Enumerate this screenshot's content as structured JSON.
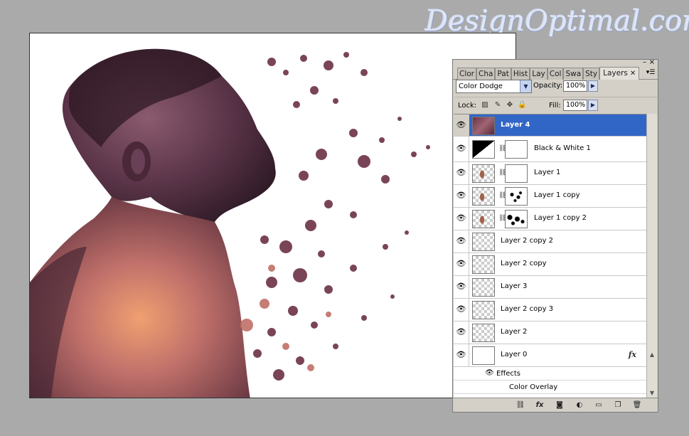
{
  "watermark": "DesignOptimal.com",
  "panel": {
    "tabs": [
      "Clor",
      "Cha",
      "Pat",
      "Hist",
      "Lay",
      "Col",
      "Swa",
      "Sty"
    ],
    "active_tab": "Layers",
    "blend_mode": "Color Dodge",
    "opacity_label": "Opacity:",
    "opacity_value": "100%",
    "lock_label": "Lock:",
    "fill_label": "Fill:",
    "fill_value": "100%",
    "layers": [
      {
        "name": "Layer 4",
        "thumb": "gradient",
        "selected": true
      },
      {
        "name": "Black & White 1",
        "thumb": "bw",
        "mask": "white"
      },
      {
        "name": "Layer 1",
        "thumb": "portrait",
        "mask": "white"
      },
      {
        "name": "Layer 1 copy",
        "thumb": "portrait",
        "mask": "speckle"
      },
      {
        "name": "Layer 1 copy 2",
        "thumb": "portrait",
        "mask": "speckle2"
      },
      {
        "name": "Layer 2 copy 2",
        "thumb": "checker"
      },
      {
        "name": "Layer 2 copy",
        "thumb": "checker"
      },
      {
        "name": "Layer 3",
        "thumb": "checker"
      },
      {
        "name": "Layer 2 copy 3",
        "thumb": "checker"
      },
      {
        "name": "Layer 2",
        "thumb": "checker"
      },
      {
        "name": "Layer 0",
        "thumb": "white",
        "fx": "fx"
      }
    ],
    "effects_label": "Effects",
    "effect_item": "Color Overlay"
  },
  "icons": {
    "visibility": "eye-icon",
    "link": "chain-link-icon",
    "panel_menu": "panel-menu-icon",
    "lock_transparent": "lock-transparent-icon",
    "lock_image": "brush-icon",
    "lock_position": "move-icon",
    "lock_all": "lock-icon"
  },
  "colors": {
    "selection": "#3166c7",
    "panel_bg": "#d4d0c8",
    "app_bg": "#aaaaaa"
  }
}
